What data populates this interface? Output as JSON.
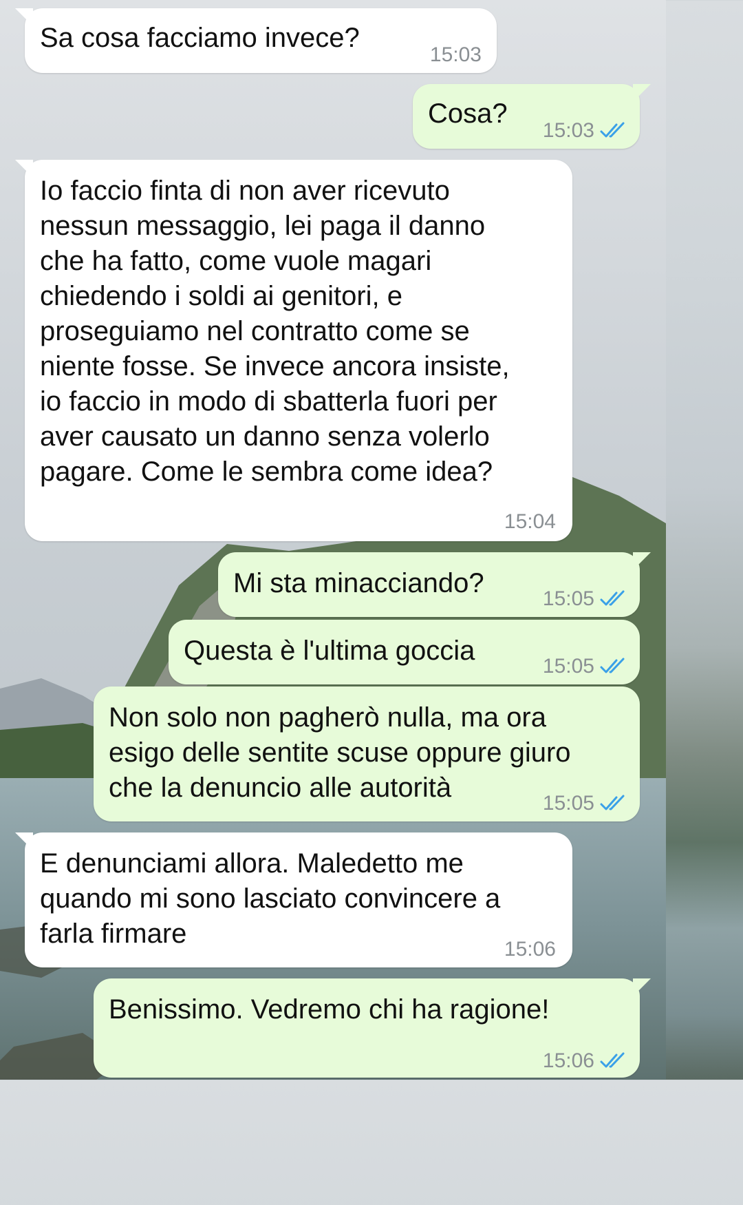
{
  "messages": [
    {
      "dir": "in",
      "text": "Sa cosa facciamo invece?",
      "time": "15:03"
    },
    {
      "dir": "out",
      "text": "Cosa?",
      "time": "15:03",
      "status_icon": "double-check-icon"
    },
    {
      "dir": "in",
      "text": "Io faccio finta di non aver ricevuto\nnessun messaggio, lei paga il danno\nche ha fatto, come vuole magari\nchiedendo i soldi ai genitori, e\nproseguiamo nel contratto come se\nniente fosse. Se invece ancora insiste,\nio faccio in modo di sbatterla fuori per\naver causato un danno senza volerlo\npagare. Come le sembra come idea?",
      "time": "15:04"
    },
    {
      "dir": "out",
      "text": "Mi sta minacciando?",
      "time": "15:05",
      "status_icon": "double-check-icon"
    },
    {
      "dir": "out",
      "text": "Questa è l'ultima goccia",
      "time": "15:05",
      "status_icon": "double-check-icon"
    },
    {
      "dir": "out",
      "text": "Non solo non pagherò nulla, ma ora\nesigo delle sentite scuse oppure giuro\nche la denuncio alle autorità",
      "time": "15:05",
      "status_icon": "double-check-icon"
    },
    {
      "dir": "in",
      "text": "E denunciami allora. Maledetto me\nquando mi sono lasciato convincere a\nfarla firmare",
      "time": "15:06"
    },
    {
      "dir": "out",
      "text": "Benissimo. Vedremo chi ha ragione!",
      "time": "15:06",
      "status_icon": "double-check-icon"
    }
  ],
  "colors": {
    "incoming_bubble": "#ffffff",
    "outgoing_bubble": "#e7fbd9",
    "timestamp": "#8a8f93",
    "read_check": "#3aa0e8"
  }
}
